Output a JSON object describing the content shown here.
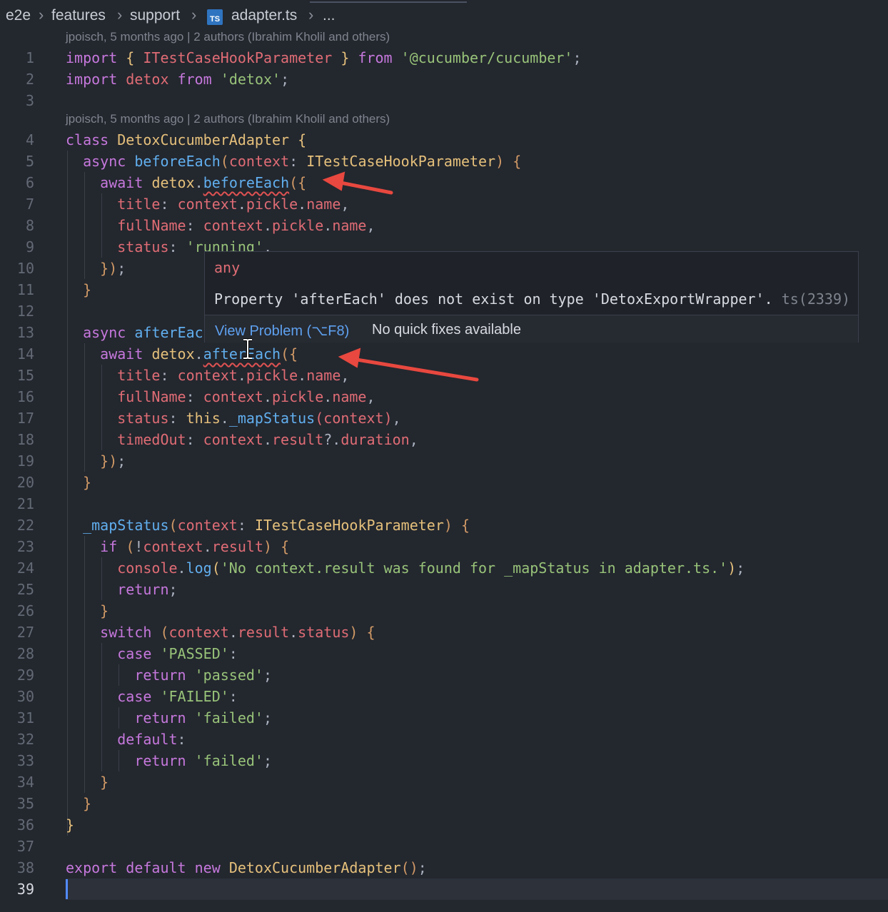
{
  "breadcrumb": {
    "items": [
      "e2e",
      "features",
      "support",
      "adapter.ts",
      "..."
    ],
    "file_icon_label": "TS"
  },
  "blame": [
    "jpoisch, 5 months ago | 2 authors (Ibrahim Kholil and others)",
    "jpoisch, 5 months ago | 2 authors (Ibrahim Kholil and others)"
  ],
  "line_numbers": [
    "1",
    "2",
    "3",
    "4",
    "5",
    "6",
    "7",
    "8",
    "9",
    "10",
    "11",
    "12",
    "13",
    "14",
    "15",
    "16",
    "17",
    "18",
    "19",
    "20",
    "21",
    "22",
    "23",
    "24",
    "25",
    "26",
    "27",
    "28",
    "29",
    "30",
    "31",
    "32",
    "33",
    "34",
    "35",
    "36",
    "37",
    "38",
    "39"
  ],
  "active_line": "39",
  "code_tokens": {
    "l1": [
      "import",
      "{",
      "ITestCaseHookParameter",
      "}",
      "from",
      "'@cucumber/cucumber'",
      ";"
    ],
    "l2": [
      "import",
      "detox",
      "from",
      "'detox'",
      ";"
    ],
    "l4": [
      "class",
      "DetoxCucumberAdapter",
      "{"
    ],
    "l5": [
      "async",
      "beforeEach",
      "(",
      "context",
      ":",
      "ITestCaseHookParameter",
      ")",
      "{"
    ],
    "l6": [
      "await",
      "detox",
      ".",
      "beforeEach",
      "(",
      "{"
    ],
    "l7": [
      "title",
      ":",
      "context",
      ".",
      "pickle",
      ".",
      "name",
      ","
    ],
    "l8": [
      "fullName",
      ":",
      "context",
      ".",
      "pickle",
      ".",
      "name",
      ","
    ],
    "l9": [
      "status",
      ":",
      "'running'",
      ","
    ],
    "l10": [
      "}",
      ")",
      ";"
    ],
    "l11": [
      "}"
    ],
    "l13": [
      "async",
      "afterEac"
    ],
    "l14": [
      "await",
      "detox",
      ".",
      "afterEach",
      "(",
      "{"
    ],
    "l15": [
      "title",
      ":",
      "context",
      ".",
      "pickle",
      ".",
      "name",
      ","
    ],
    "l16": [
      "fullName",
      ":",
      "context",
      ".",
      "pickle",
      ".",
      "name",
      ","
    ],
    "l17": [
      "status",
      ":",
      "this",
      ".",
      "_mapStatus",
      "(",
      "context",
      ")",
      ","
    ],
    "l18": [
      "timedOut",
      ":",
      "context",
      ".",
      "result",
      "?.",
      "duration",
      ","
    ],
    "l19": [
      "}",
      ")",
      ";"
    ],
    "l20": [
      "}"
    ],
    "l22": [
      "_mapStatus",
      "(",
      "context",
      ":",
      "ITestCaseHookParameter",
      ")",
      "{"
    ],
    "l23": [
      "if",
      "(",
      "!",
      "context",
      ".",
      "result",
      ")",
      "{"
    ],
    "l24": [
      "console",
      ".",
      "log",
      "(",
      "'No context.result was found for _mapStatus in adapter.ts.'",
      ")",
      ";"
    ],
    "l25": [
      "return",
      ";"
    ],
    "l26": [
      "}"
    ],
    "l27": [
      "switch",
      "(",
      "context",
      ".",
      "result",
      ".",
      "status",
      ")",
      "{"
    ],
    "l28": [
      "case",
      "'PASSED'",
      ":"
    ],
    "l29": [
      "return",
      "'passed'",
      ";"
    ],
    "l30": [
      "case",
      "'FAILED'",
      ":"
    ],
    "l31": [
      "return",
      "'failed'",
      ";"
    ],
    "l32": [
      "default",
      ":"
    ],
    "l33": [
      "return",
      "'failed'",
      ";"
    ],
    "l34": [
      "}"
    ],
    "l35": [
      "}"
    ],
    "l36": [
      "}"
    ],
    "l38": [
      "export",
      "default",
      "new",
      "DetoxCucumberAdapter",
      "(",
      ")",
      ";"
    ]
  },
  "hover": {
    "type": "any",
    "message": "Property 'afterEach' does not exist on type 'DetoxExportWrapper'.",
    "code": "ts(2339)",
    "view_problem": "View Problem (⌥F8)",
    "no_fixes": "No quick fixes available"
  },
  "colors": {
    "background": "#23272e",
    "keyword": "#c678dd",
    "variable": "#e06c75",
    "string": "#98c379",
    "function": "#61afef",
    "class": "#e5c07b",
    "error_squiggle": "#e05252",
    "annotation_arrow": "#e8483f",
    "link": "#5ea1f0"
  }
}
